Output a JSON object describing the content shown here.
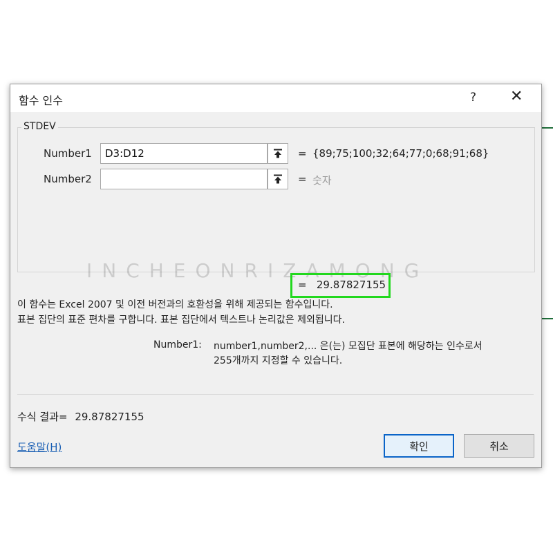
{
  "dialog": {
    "title": "함수 인수",
    "help_glyph": "?",
    "close_glyph": "✕",
    "function_name": "STDEV",
    "args": [
      {
        "label": "Number1",
        "value": "D3:D12",
        "placeholder": "",
        "eq": "=",
        "evaluated": "{89;75;100;32;64;77;0;68;91;68}"
      },
      {
        "label": "Number2",
        "value": "",
        "placeholder": "",
        "eq": "=",
        "evaluated": "숫자"
      }
    ],
    "function_result": "=   29.87827155",
    "description_line1": "이 함수는 Excel 2007 및 이전 버전과의 호환성을 위해 제공되는 함수입니다.",
    "description_line2": "표본 집단의 표준 편차를 구합니다. 표본 집단에서 텍스트나 논리값은 제외됩니다.",
    "arg_desc_name": "Number1:",
    "arg_desc_line1": "number1,number2,... 은(는) 모집단 표본에 해당하는 인수로서",
    "arg_desc_line2": "255개까지 지정할 수 있습니다.",
    "formula_result_label": "수식 결과=",
    "formula_result_value": "29.87827155",
    "help_link": "도움말(H)",
    "ok_label": "확인",
    "cancel_label": "취소"
  },
  "watermark": "INCHEONRIZAMONG",
  "colors": {
    "highlight": "#22d81e",
    "primary_border": "#0a64c8",
    "link": "#1a5fb4"
  }
}
